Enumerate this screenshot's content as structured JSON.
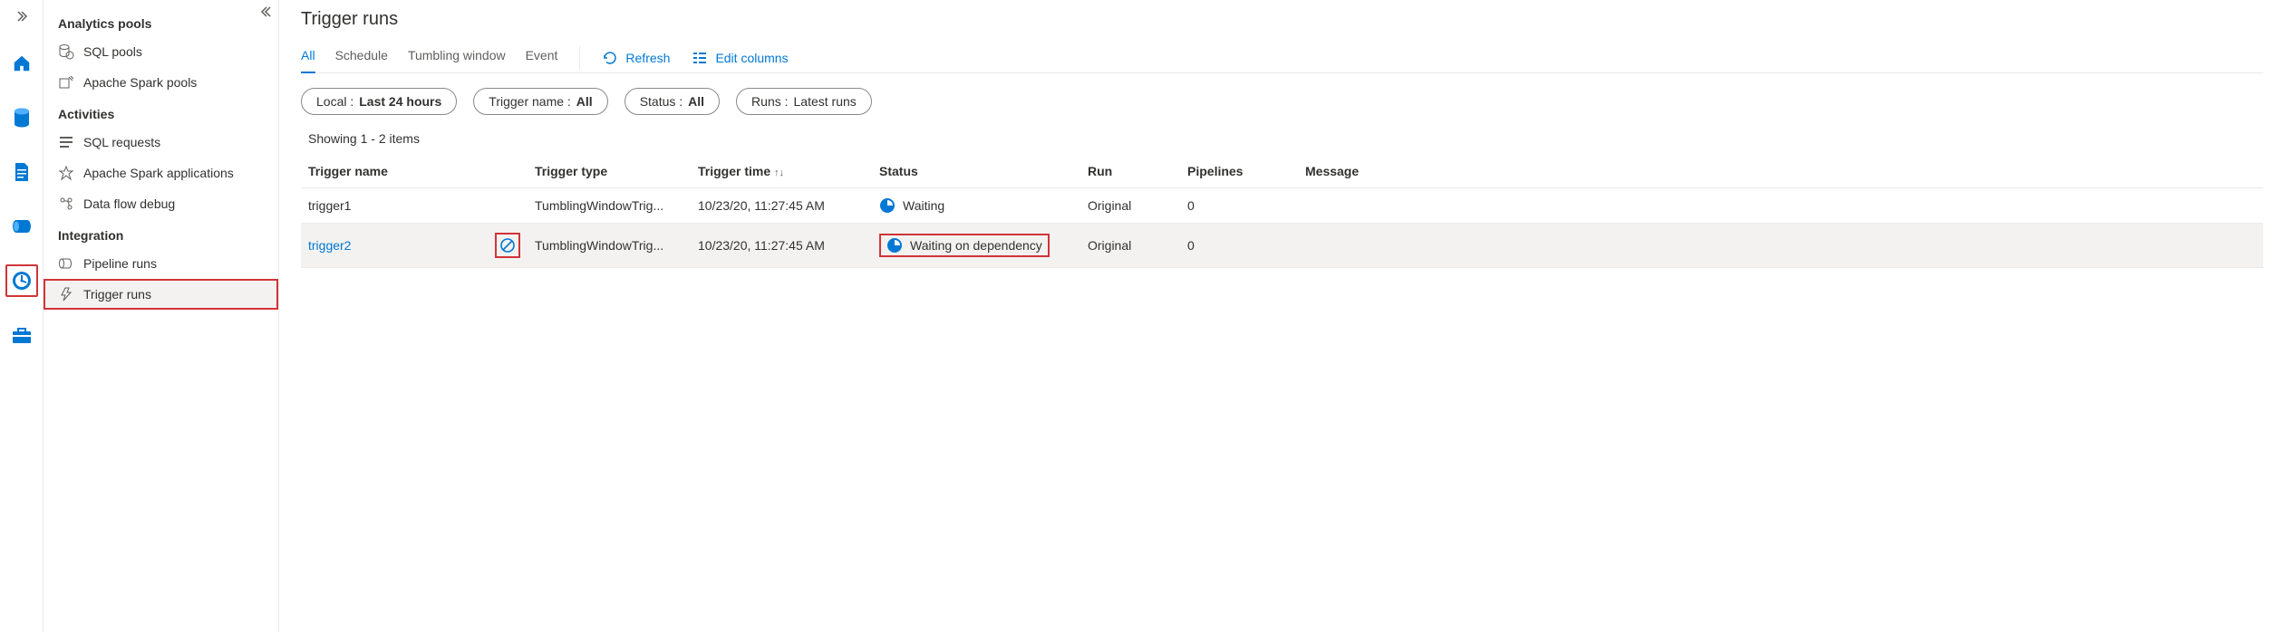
{
  "iconRail": {
    "items": [
      "home",
      "database",
      "document",
      "pipeline",
      "monitor",
      "toolbox"
    ],
    "selected": "monitor"
  },
  "sidebar": {
    "groups": [
      {
        "title": "Analytics pools",
        "items": [
          {
            "icon": "sql-pools",
            "label": "SQL pools"
          },
          {
            "icon": "spark-pools",
            "label": "Apache Spark pools"
          }
        ]
      },
      {
        "title": "Activities",
        "items": [
          {
            "icon": "sql-requests",
            "label": "SQL requests"
          },
          {
            "icon": "spark-apps",
            "label": "Apache Spark applications"
          },
          {
            "icon": "dataflow-debug",
            "label": "Data flow debug"
          }
        ]
      },
      {
        "title": "Integration",
        "items": [
          {
            "icon": "pipeline-runs",
            "label": "Pipeline runs"
          },
          {
            "icon": "trigger-runs",
            "label": "Trigger runs",
            "highlight": true
          }
        ]
      }
    ]
  },
  "page": {
    "title": "Trigger runs",
    "tabs": [
      {
        "label": "All",
        "active": true
      },
      {
        "label": "Schedule"
      },
      {
        "label": "Tumbling window"
      },
      {
        "label": "Event"
      }
    ],
    "actions": {
      "refresh": "Refresh",
      "editColumns": "Edit columns"
    },
    "filters": [
      {
        "prefix": "Local : ",
        "value": "Last 24 hours",
        "bold": true
      },
      {
        "prefix": "Trigger name : ",
        "value": "All",
        "bold": true
      },
      {
        "prefix": "Status : ",
        "value": "All",
        "bold": true
      },
      {
        "prefix": "Runs : ",
        "value": "Latest runs",
        "bold": false
      }
    ],
    "itemsText": "Showing 1 - 2 items",
    "columns": [
      "Trigger name",
      "Trigger type",
      "Trigger time",
      "Status",
      "Run",
      "Pipelines",
      "Message"
    ],
    "rows": [
      {
        "name": "trigger1",
        "link": false,
        "type": "TumblingWindowTrig...",
        "time": "10/23/20, 11:27:45 AM",
        "statusIcon": "waiting",
        "statusText": "Waiting",
        "statusHighlight": false,
        "run": "Original",
        "pipelines": "0",
        "message": "",
        "selected": false,
        "showStop": false
      },
      {
        "name": "trigger2",
        "link": true,
        "type": "TumblingWindowTrig...",
        "time": "10/23/20, 11:27:45 AM",
        "statusIcon": "waiting",
        "statusText": "Waiting on dependency",
        "statusHighlight": true,
        "run": "Original",
        "pipelines": "0",
        "message": "",
        "selected": true,
        "showStop": true
      }
    ]
  }
}
